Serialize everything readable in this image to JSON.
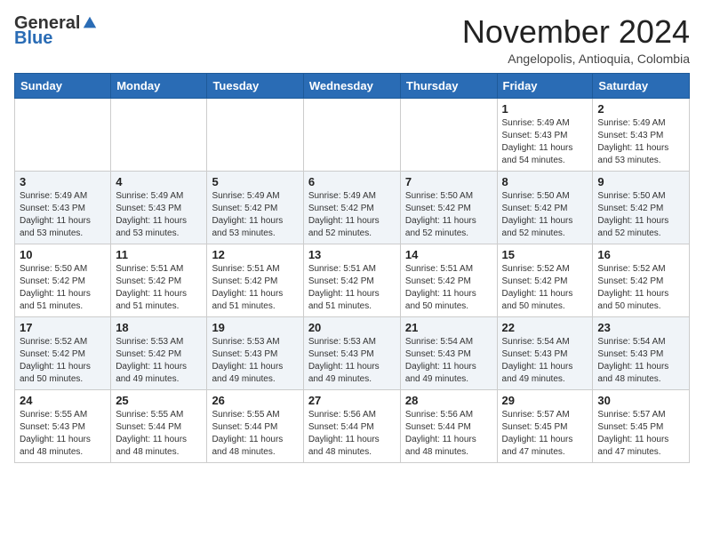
{
  "header": {
    "logo_general": "General",
    "logo_blue": "Blue",
    "month_title": "November 2024",
    "location": "Angelopolis, Antioquia, Colombia"
  },
  "weekdays": [
    "Sunday",
    "Monday",
    "Tuesday",
    "Wednesday",
    "Thursday",
    "Friday",
    "Saturday"
  ],
  "weeks": [
    [
      {
        "day": "",
        "info": ""
      },
      {
        "day": "",
        "info": ""
      },
      {
        "day": "",
        "info": ""
      },
      {
        "day": "",
        "info": ""
      },
      {
        "day": "",
        "info": ""
      },
      {
        "day": "1",
        "info": "Sunrise: 5:49 AM\nSunset: 5:43 PM\nDaylight: 11 hours\nand 54 minutes."
      },
      {
        "day": "2",
        "info": "Sunrise: 5:49 AM\nSunset: 5:43 PM\nDaylight: 11 hours\nand 53 minutes."
      }
    ],
    [
      {
        "day": "3",
        "info": "Sunrise: 5:49 AM\nSunset: 5:43 PM\nDaylight: 11 hours\nand 53 minutes."
      },
      {
        "day": "4",
        "info": "Sunrise: 5:49 AM\nSunset: 5:43 PM\nDaylight: 11 hours\nand 53 minutes."
      },
      {
        "day": "5",
        "info": "Sunrise: 5:49 AM\nSunset: 5:42 PM\nDaylight: 11 hours\nand 53 minutes."
      },
      {
        "day": "6",
        "info": "Sunrise: 5:49 AM\nSunset: 5:42 PM\nDaylight: 11 hours\nand 52 minutes."
      },
      {
        "day": "7",
        "info": "Sunrise: 5:50 AM\nSunset: 5:42 PM\nDaylight: 11 hours\nand 52 minutes."
      },
      {
        "day": "8",
        "info": "Sunrise: 5:50 AM\nSunset: 5:42 PM\nDaylight: 11 hours\nand 52 minutes."
      },
      {
        "day": "9",
        "info": "Sunrise: 5:50 AM\nSunset: 5:42 PM\nDaylight: 11 hours\nand 52 minutes."
      }
    ],
    [
      {
        "day": "10",
        "info": "Sunrise: 5:50 AM\nSunset: 5:42 PM\nDaylight: 11 hours\nand 51 minutes."
      },
      {
        "day": "11",
        "info": "Sunrise: 5:51 AM\nSunset: 5:42 PM\nDaylight: 11 hours\nand 51 minutes."
      },
      {
        "day": "12",
        "info": "Sunrise: 5:51 AM\nSunset: 5:42 PM\nDaylight: 11 hours\nand 51 minutes."
      },
      {
        "day": "13",
        "info": "Sunrise: 5:51 AM\nSunset: 5:42 PM\nDaylight: 11 hours\nand 51 minutes."
      },
      {
        "day": "14",
        "info": "Sunrise: 5:51 AM\nSunset: 5:42 PM\nDaylight: 11 hours\nand 50 minutes."
      },
      {
        "day": "15",
        "info": "Sunrise: 5:52 AM\nSunset: 5:42 PM\nDaylight: 11 hours\nand 50 minutes."
      },
      {
        "day": "16",
        "info": "Sunrise: 5:52 AM\nSunset: 5:42 PM\nDaylight: 11 hours\nand 50 minutes."
      }
    ],
    [
      {
        "day": "17",
        "info": "Sunrise: 5:52 AM\nSunset: 5:42 PM\nDaylight: 11 hours\nand 50 minutes."
      },
      {
        "day": "18",
        "info": "Sunrise: 5:53 AM\nSunset: 5:42 PM\nDaylight: 11 hours\nand 49 minutes."
      },
      {
        "day": "19",
        "info": "Sunrise: 5:53 AM\nSunset: 5:43 PM\nDaylight: 11 hours\nand 49 minutes."
      },
      {
        "day": "20",
        "info": "Sunrise: 5:53 AM\nSunset: 5:43 PM\nDaylight: 11 hours\nand 49 minutes."
      },
      {
        "day": "21",
        "info": "Sunrise: 5:54 AM\nSunset: 5:43 PM\nDaylight: 11 hours\nand 49 minutes."
      },
      {
        "day": "22",
        "info": "Sunrise: 5:54 AM\nSunset: 5:43 PM\nDaylight: 11 hours\nand 49 minutes."
      },
      {
        "day": "23",
        "info": "Sunrise: 5:54 AM\nSunset: 5:43 PM\nDaylight: 11 hours\nand 48 minutes."
      }
    ],
    [
      {
        "day": "24",
        "info": "Sunrise: 5:55 AM\nSunset: 5:43 PM\nDaylight: 11 hours\nand 48 minutes."
      },
      {
        "day": "25",
        "info": "Sunrise: 5:55 AM\nSunset: 5:44 PM\nDaylight: 11 hours\nand 48 minutes."
      },
      {
        "day": "26",
        "info": "Sunrise: 5:55 AM\nSunset: 5:44 PM\nDaylight: 11 hours\nand 48 minutes."
      },
      {
        "day": "27",
        "info": "Sunrise: 5:56 AM\nSunset: 5:44 PM\nDaylight: 11 hours\nand 48 minutes."
      },
      {
        "day": "28",
        "info": "Sunrise: 5:56 AM\nSunset: 5:44 PM\nDaylight: 11 hours\nand 48 minutes."
      },
      {
        "day": "29",
        "info": "Sunrise: 5:57 AM\nSunset: 5:45 PM\nDaylight: 11 hours\nand 47 minutes."
      },
      {
        "day": "30",
        "info": "Sunrise: 5:57 AM\nSunset: 5:45 PM\nDaylight: 11 hours\nand 47 minutes."
      }
    ]
  ]
}
